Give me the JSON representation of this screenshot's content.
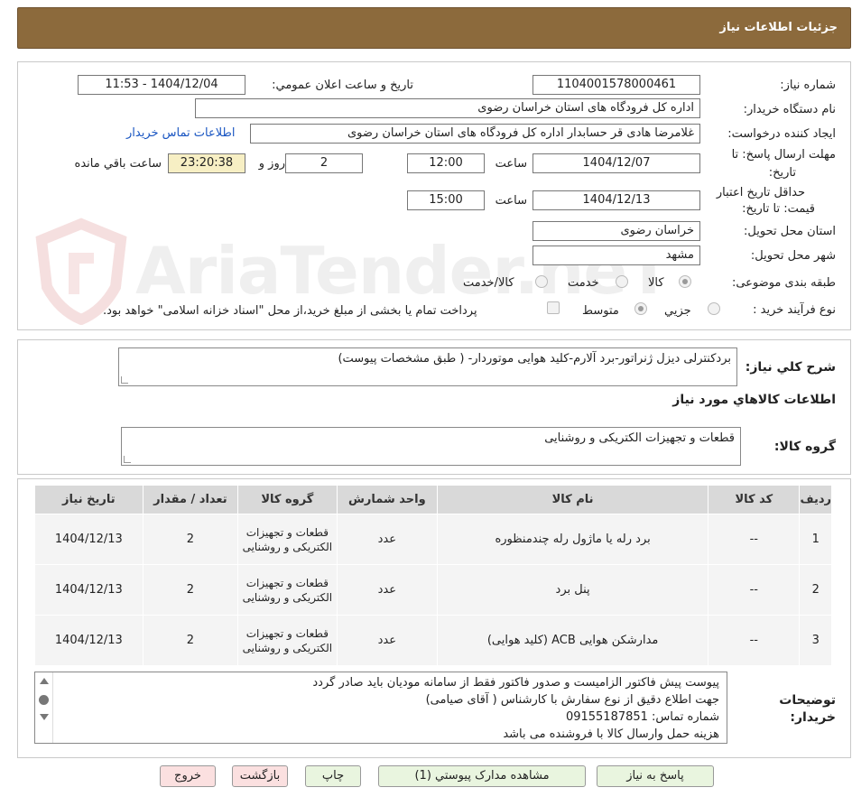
{
  "header": {
    "title": "جزئیات اطلاعات نیاز"
  },
  "form": {
    "need_number_label": "شماره نیاز:",
    "need_number": "1104001578000461",
    "announce_label": "تاریخ و ساعت اعلان عمومي:",
    "announce_value": "1404/12/04 - 11:53",
    "buyer_label": "نام دستگاه خریدار:",
    "buyer_value": "اداره کل فرودگاه های استان خراسان رضوی",
    "creator_label": "ایجاد کننده درخواست:",
    "creator_value": "غلامرضا هادی قر حسابدار اداره کل فرودگاه های استان خراسان رضوی",
    "contact_link": "اطلاعات تماس خریدار",
    "deadline_label_1": "مهلت ارسال پاسخ: تا",
    "deadline_label_2": "تاریخ:",
    "deadline_date": "1404/12/07",
    "time_label": "ساعت",
    "deadline_time": "12:00",
    "days_value": "2",
    "days_label": "روز و",
    "remaining_time": "23:20:38",
    "remaining_label": "ساعت باقي مانده",
    "validity_label_1": "حداقل تاریخ اعتبار",
    "validity_label_2": "قیمت: تا تاریخ:",
    "validity_date": "1404/12/13",
    "validity_time": "15:00",
    "province_label": "استان محل تحویل:",
    "province_value": "خراسان رضوی",
    "city_label": "شهر محل تحویل:",
    "city_value": "مشهد",
    "category_label": "طبقه بندی موضوعی:",
    "category_options": [
      "کالا",
      "خدمت",
      "کالا/خدمت"
    ],
    "category_selected": "کالا",
    "process_label": "نوع فرآیند خرید :",
    "process_options": [
      "جزیي",
      "متوسط"
    ],
    "process_selected": "متوسط",
    "payment_note": "پرداخت تمام یا بخشی از مبلغ خرید،از محل \"اسناد خزانه اسلامی\" خواهد بود."
  },
  "description": {
    "label": "شرح کلي نیاز:",
    "value": "بردکنترلی دیزل ژنراتور-برد آلارم-کلید هوایی موتوردار- ( طبق مشخصات پیوست)"
  },
  "goods": {
    "section_title": "اطلاعات کالاهاي مورد نیاز",
    "group_label": "گروه کالا:",
    "group_value": "قطعات و تجهیزات الکتریکی و روشنایی"
  },
  "table": {
    "headers": [
      "ردیف",
      "کد کالا",
      "نام کالا",
      "واحد شمارش",
      "گروه کالا",
      "تعداد / مقدار",
      "تاریخ نیاز"
    ],
    "rows": [
      {
        "row": "1",
        "code": "--",
        "name": "برد رله یا ماژول رله چندمنظوره",
        "unit": "عدد",
        "group": "قطعات و تجهیزات الکتریکی و روشنایی",
        "qty": "2",
        "date": "1404/12/13"
      },
      {
        "row": "2",
        "code": "--",
        "name": "پنل برد",
        "unit": "عدد",
        "group": "قطعات و تجهیزات الکتریکی و روشنایی",
        "qty": "2",
        "date": "1404/12/13"
      },
      {
        "row": "3",
        "code": "--",
        "name": "مدارشکن هوایی ACB (کلید هوایی)",
        "unit": "عدد",
        "group": "قطعات و تجهیزات الکتریکی و روشنایی",
        "qty": "2",
        "date": "1404/12/13"
      }
    ]
  },
  "notes": {
    "label_1": "توضیحات",
    "label_2": "خریدار:",
    "lines": [
      "پیوست پیش فاکتور الزامیست و صدور فاکتور فقط از سامانه مودیان باید صادر گردد",
      "جهت اطلاع دقیق از نوع سفارش با کارشناس   ( آقای صیامی)",
      "شماره تماس:  09155187851",
      "هزینه حمل وارسال کالا با فروشنده می باشد"
    ]
  },
  "buttons": {
    "reply": "پاسخ به نیاز",
    "attachments": "مشاهده مدارک پیوستي (1)",
    "print": "چاپ",
    "back": "بازگشت",
    "exit": "خروج"
  },
  "watermark": {
    "text": "AriaTender.neT"
  }
}
